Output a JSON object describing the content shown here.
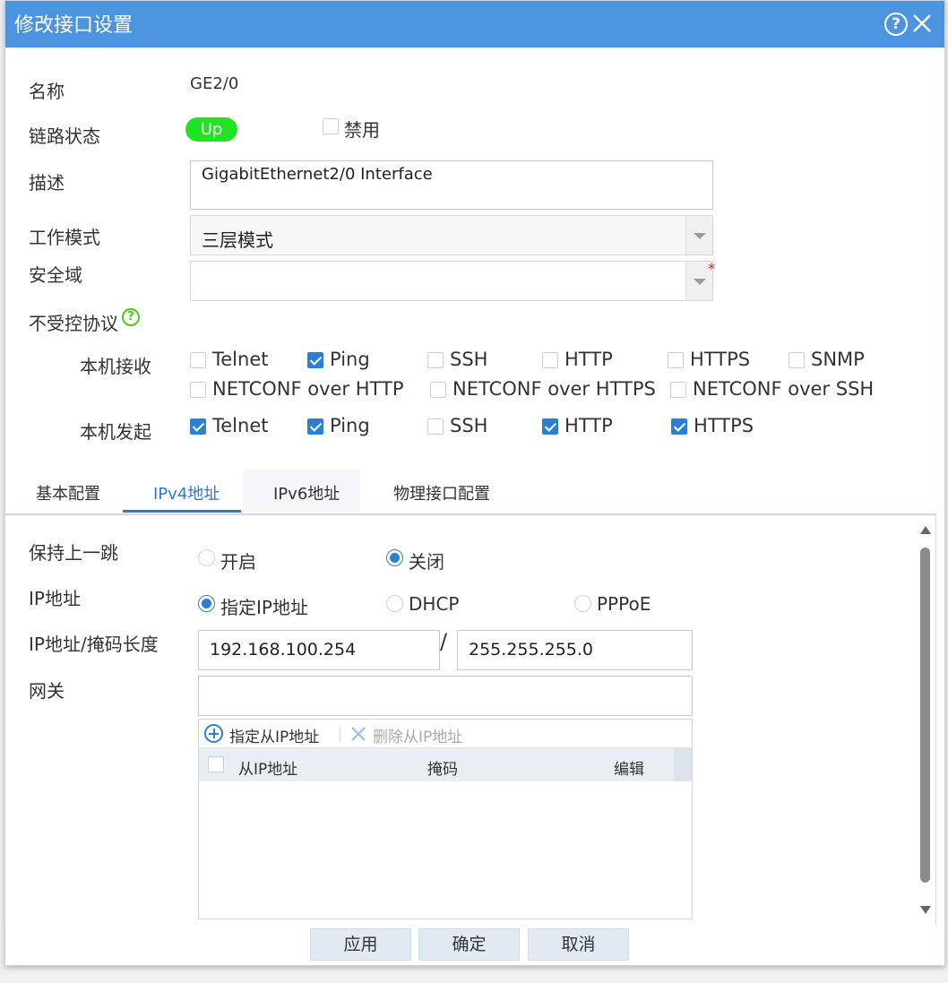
{
  "dialog": {
    "title": "修改接口设置"
  },
  "form": {
    "name_label": "名称",
    "name_value": "GE2/0",
    "link_label": "链路状态",
    "link_status": "Up",
    "disable_label": "禁用",
    "desc_label": "描述",
    "desc_value": "GigabitEthernet2/0 Interface",
    "mode_label": "工作模式",
    "mode_value": "三层模式",
    "zone_label": "安全域",
    "zone_value": "",
    "required_mark": "*",
    "uncontrolled_label": "不受控协议",
    "help_glyph": "?"
  },
  "protocols": {
    "receive_label": "本机接收",
    "receive": [
      {
        "name": "Telnet",
        "checked": false
      },
      {
        "name": "Ping",
        "checked": true
      },
      {
        "name": "SSH",
        "checked": false
      },
      {
        "name": "HTTP",
        "checked": false
      },
      {
        "name": "HTTPS",
        "checked": false
      },
      {
        "name": "SNMP",
        "checked": false
      },
      {
        "name": "NETCONF over HTTP",
        "checked": false
      },
      {
        "name": "NETCONF over HTTPS",
        "checked": false
      },
      {
        "name": "NETCONF over SSH",
        "checked": false
      }
    ],
    "initiate_label": "本机发起",
    "initiate": [
      {
        "name": "Telnet",
        "checked": true
      },
      {
        "name": "Ping",
        "checked": true
      },
      {
        "name": "SSH",
        "checked": false
      },
      {
        "name": "HTTP",
        "checked": true
      },
      {
        "name": "HTTPS",
        "checked": true
      }
    ]
  },
  "tabs": [
    {
      "label": "基本配置"
    },
    {
      "label": "IPv4地址",
      "active": true
    },
    {
      "label": "IPv6地址"
    },
    {
      "label": "物理接口配置"
    }
  ],
  "ipv4": {
    "keep_hop_label": "保持上一跳",
    "keep_on": "开启",
    "keep_off": "关闭",
    "ip_label": "IP地址",
    "ip_static": "指定IP地址",
    "ip_dhcp": "DHCP",
    "ip_pppoe": "PPPoE",
    "ipmask_label": "IP地址/掩码长度",
    "ip_value": "192.168.100.254",
    "slash": "/",
    "mask_value": "255.255.255.0",
    "gateway_label": "网关",
    "gateway_value": "",
    "secondary": {
      "add_label": "指定从IP地址",
      "delete_label": "删除从IP地址",
      "col_ip": "从IP地址",
      "col_mask": "掩码",
      "col_edit": "编辑"
    }
  },
  "buttons": {
    "apply": "应用",
    "ok": "确定",
    "cancel": "取消"
  },
  "colors": {
    "titlebar": "#4d94e0",
    "accent": "#2d7fd6",
    "status_up": "#21e321"
  }
}
